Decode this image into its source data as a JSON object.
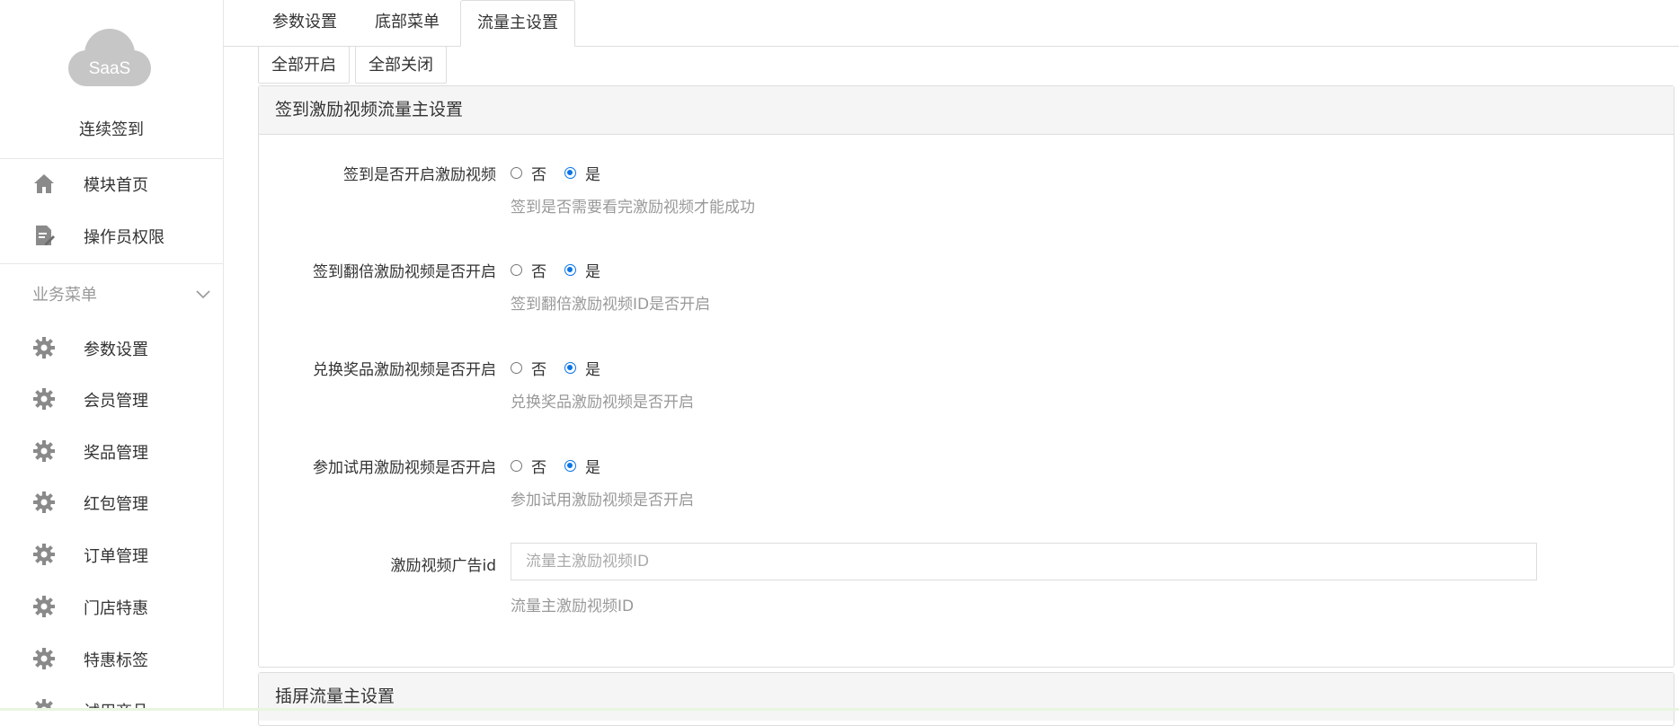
{
  "sidebar": {
    "logo_text": "SaaS",
    "module_name": "连续签到",
    "top_items": [
      {
        "label": "模块首页",
        "icon": "home-icon"
      },
      {
        "label": "操作员权限",
        "icon": "document-edit-icon"
      }
    ],
    "section_title": "业务菜单",
    "business_items": [
      {
        "label": "参数设置",
        "icon": "gear-icon"
      },
      {
        "label": "会员管理",
        "icon": "gear-icon"
      },
      {
        "label": "奖品管理",
        "icon": "gear-icon"
      },
      {
        "label": "红包管理",
        "icon": "gear-icon"
      },
      {
        "label": "订单管理",
        "icon": "gear-icon"
      },
      {
        "label": "门店特惠",
        "icon": "gear-icon"
      },
      {
        "label": "特惠标签",
        "icon": "gear-icon"
      },
      {
        "label": "试用商品",
        "icon": "gear-icon"
      }
    ]
  },
  "tabs": [
    {
      "label": "参数设置",
      "active": false
    },
    {
      "label": "底部菜单",
      "active": false
    },
    {
      "label": "流量主设置",
      "active": true
    }
  ],
  "sub_buttons": {
    "enable_all": "全部开启",
    "disable_all": "全部关闭"
  },
  "panel_reward": {
    "title": "签到激励视频流量主设置",
    "rows": [
      {
        "label": "签到是否开启激励视频",
        "no": "否",
        "yes": "是",
        "selected": "是",
        "help": "签到是否需要看完激励视频才能成功"
      },
      {
        "label": "签到翻倍激励视频是否开启",
        "no": "否",
        "yes": "是",
        "selected": "是",
        "help": "签到翻倍激励视频ID是否开启"
      },
      {
        "label": "兑换奖品激励视频是否开启",
        "no": "否",
        "yes": "是",
        "selected": "是",
        "help": "兑换奖品激励视频是否开启"
      },
      {
        "label": "参加试用激励视频是否开启",
        "no": "否",
        "yes": "是",
        "selected": "是",
        "help": "参加试用激励视频是否开启"
      }
    ],
    "ad_id": {
      "label": "激励视频广告id",
      "value": "",
      "placeholder": "流量主激励视频ID",
      "help": "流量主激励视频ID"
    }
  },
  "panel_interstitial": {
    "title": "插屏流量主设置"
  },
  "colors": {
    "accent": "#0b75e6",
    "logo_cloud": "#c6c6c6"
  }
}
